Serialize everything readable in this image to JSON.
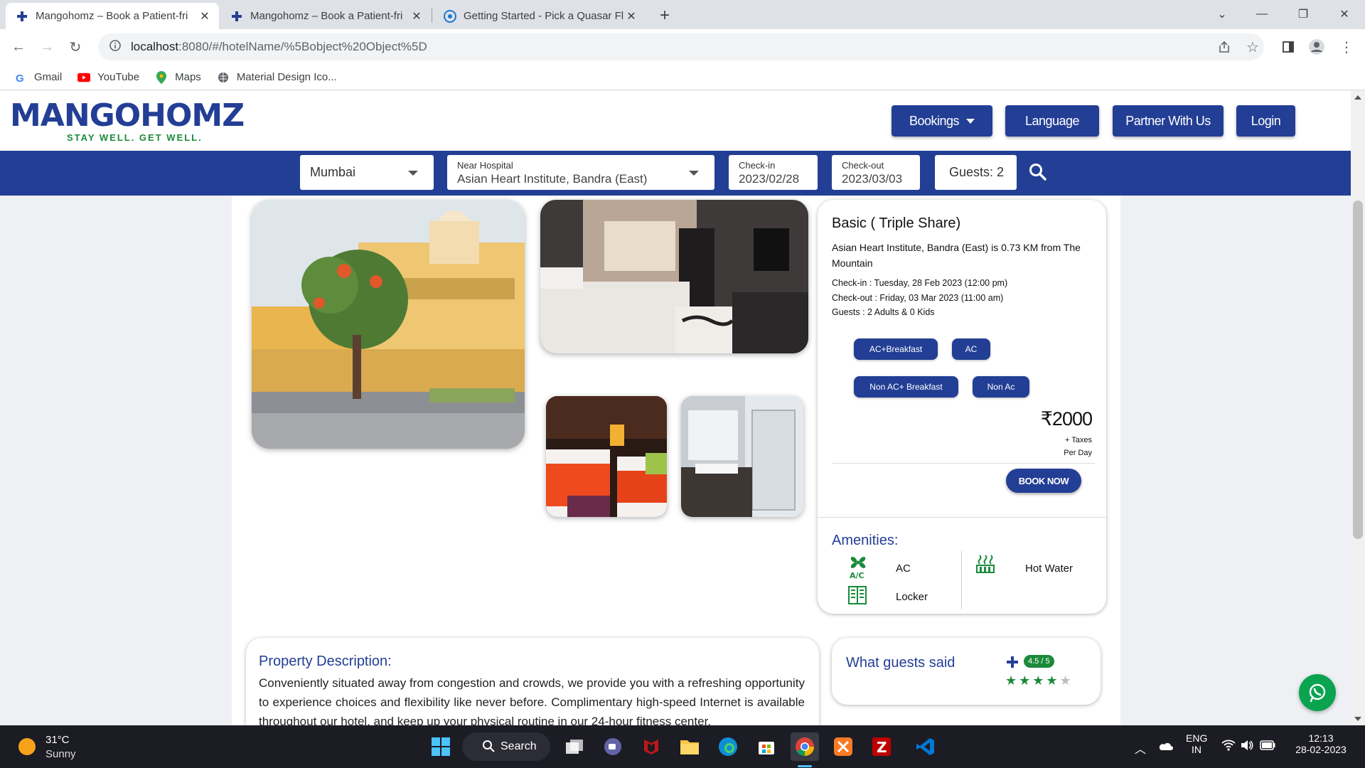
{
  "browser": {
    "tabs": [
      {
        "title": "Mangohomz – Book a Patient-fri",
        "active": true
      },
      {
        "title": "Mangohomz – Book a Patient-fri",
        "active": false
      },
      {
        "title": "Getting Started - Pick a Quasar Fl",
        "active": false
      }
    ],
    "url_host": "localhost",
    "url_rest": ":8080/#/hotelName/%5Bobject%20Object%5D",
    "bookmarks": [
      "Gmail",
      "YouTube",
      "Maps",
      "Material Design Ico..."
    ]
  },
  "site": {
    "logo_text": "MANGOHOMZ",
    "tagline": "STAY WELL. GET WELL.",
    "nav": {
      "bookings": "Bookings",
      "language": "Language",
      "partner": "Partner With Us",
      "login": "Login"
    },
    "search": {
      "city": "Mumbai",
      "hospital_label": "Near Hospital",
      "hospital": "Asian Heart Institute, Bandra (East)",
      "checkin_label": "Check-in",
      "checkin": "2023/02/28",
      "checkout_label": "Check-out",
      "checkout": "2023/03/03",
      "guests": "Guests: 2"
    }
  },
  "room": {
    "title": "Basic ( Triple Share)",
    "distance": "Asian Heart Institute, Bandra (East) is 0.73 KM from The Mountain",
    "checkin": "Check-in : Tuesday, 28 Feb 2023 (12:00 pm)",
    "checkout": "Check-out : Friday, 03 Mar 2023 (11:00 am)",
    "guests": "Guests : 2 Adults & 0 Kids",
    "options": [
      "AC+Breakfast",
      "AC",
      "Non AC+ Breakfast",
      "Non Ac"
    ],
    "price": "₹2000",
    "taxes": "+ Taxes",
    "per_day": "Per Day",
    "book_now": "BOOK NOW",
    "amenities_title": "Amenities:",
    "amenities": [
      {
        "label": "AC",
        "icon": "ac-icon"
      },
      {
        "label": "Hot Water",
        "icon": "hot-water-icon"
      },
      {
        "label": "Locker",
        "icon": "locker-icon"
      }
    ]
  },
  "description": {
    "title": "Property Description:",
    "text": "Conveniently situated away from congestion and crowds, we provide you with a refreshing opportunity to experience choices and flexibility like never before. Complimentary high-speed Internet is available throughout our hotel, and keep up your physical routine in our 24-hour fitness center."
  },
  "reviews": {
    "title": "What guests said",
    "rating": "4.5 / 5",
    "stars_filled": 4,
    "stars_total": 5
  },
  "taskbar": {
    "temp": "31°C",
    "weather": "Sunny",
    "search": "Search",
    "lang1": "ENG",
    "lang2": "IN",
    "time": "12:13",
    "date": "28-02-2023"
  },
  "colors": {
    "brand_blue": "#233e95",
    "brand_green": "#1b8a3a"
  }
}
